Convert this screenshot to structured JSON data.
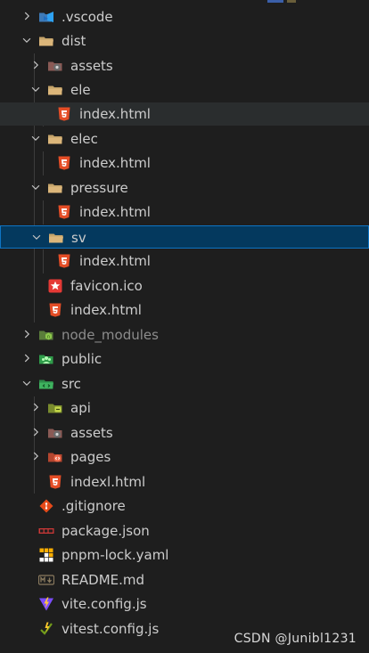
{
  "explorer": {
    "items": [
      {
        "label": ".vscode",
        "icon": "vscode-folder-icon",
        "chevron": "right"
      },
      {
        "label": "dist",
        "icon": "folder-open-icon",
        "chevron": "down"
      },
      {
        "label": "assets",
        "icon": "assets-folder-icon",
        "chevron": "right"
      },
      {
        "label": "ele",
        "icon": "folder-open-icon",
        "chevron": "down"
      },
      {
        "label": "index.html",
        "icon": "html5-icon",
        "chevron": ""
      },
      {
        "label": "elec",
        "icon": "folder-open-icon",
        "chevron": "down"
      },
      {
        "label": "index.html",
        "icon": "html5-icon",
        "chevron": ""
      },
      {
        "label": "pressure",
        "icon": "folder-open-icon",
        "chevron": "down"
      },
      {
        "label": "index.html",
        "icon": "html5-icon",
        "chevron": ""
      },
      {
        "label": "sv",
        "icon": "folder-open-icon",
        "chevron": "down"
      },
      {
        "label": "index.html",
        "icon": "html5-icon",
        "chevron": ""
      },
      {
        "label": "favicon.ico",
        "icon": "favicon-star-icon",
        "chevron": ""
      },
      {
        "label": "index.html",
        "icon": "html5-icon",
        "chevron": ""
      },
      {
        "label": "node_modules",
        "icon": "node-modules-folder-icon",
        "chevron": "right"
      },
      {
        "label": "public",
        "icon": "public-folder-icon",
        "chevron": "right"
      },
      {
        "label": "src",
        "icon": "src-folder-icon",
        "chevron": "down"
      },
      {
        "label": "api",
        "icon": "api-folder-icon",
        "chevron": "right"
      },
      {
        "label": "assets",
        "icon": "assets-folder-icon",
        "chevron": "right"
      },
      {
        "label": "pages",
        "icon": "pages-folder-icon",
        "chevron": "right"
      },
      {
        "label": "indexl.html",
        "icon": "html5-icon",
        "chevron": ""
      },
      {
        "label": ".gitignore",
        "icon": "git-icon",
        "chevron": ""
      },
      {
        "label": "package.json",
        "icon": "npm-icon",
        "chevron": ""
      },
      {
        "label": "pnpm-lock.yaml",
        "icon": "pnpm-icon",
        "chevron": ""
      },
      {
        "label": "README.md",
        "icon": "markdown-icon",
        "chevron": ""
      },
      {
        "label": "vite.config.js",
        "icon": "vite-icon",
        "chevron": ""
      },
      {
        "label": "vitest.config.js",
        "icon": "vitest-icon",
        "chevron": ""
      }
    ],
    "selected_index": 9,
    "hover_index": 4
  },
  "watermark": "CSDN @Junibl1231",
  "colors": {
    "background": "#1e1e1e",
    "selected_bg": "#04395e",
    "selected_border": "#0e74c4",
    "hover_bg": "#2a2d2e",
    "text": "#cccccc"
  }
}
